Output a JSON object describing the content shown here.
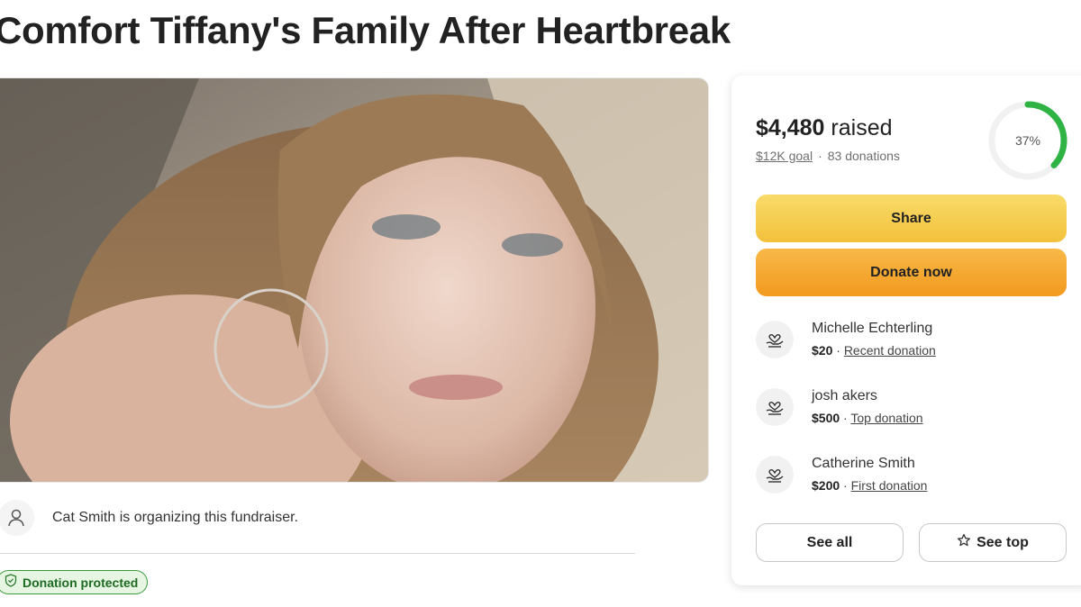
{
  "page": {
    "title": "Comfort Tiffany's Family After Heartbreak"
  },
  "organizer": {
    "text": "Cat Smith is organizing this fundraiser.",
    "icon": "user-icon"
  },
  "badge": {
    "label": "Donation protected",
    "icon": "shield-check-icon",
    "color": "#3a9a3e"
  },
  "progress": {
    "raised": "$4,480",
    "raised_suffix": " raised",
    "goal": "$12K goal",
    "separator": "·",
    "donations": "83 donations",
    "percent_label": "37%",
    "percent_value": 37,
    "ring_color": "#2fb344"
  },
  "actions": {
    "share_label": "Share",
    "donate_label": "Donate now",
    "share_color": "#f5cd4f",
    "donate_color": "#f5a732"
  },
  "donations": [
    {
      "name": "Michelle Echterling",
      "amount": "$20",
      "sep": " · ",
      "tag": "Recent donation",
      "icon": "heart-hand-icon"
    },
    {
      "name": "josh akers",
      "amount": "$500",
      "sep": " · ",
      "tag": "Top donation",
      "icon": "heart-hand-icon"
    },
    {
      "name": "Catherine Smith",
      "amount": "$200",
      "sep": " · ",
      "tag": "First donation",
      "icon": "heart-hand-icon"
    }
  ],
  "footer_buttons": {
    "see_all": "See all",
    "see_top": "See top",
    "see_top_icon": "star-icon"
  }
}
